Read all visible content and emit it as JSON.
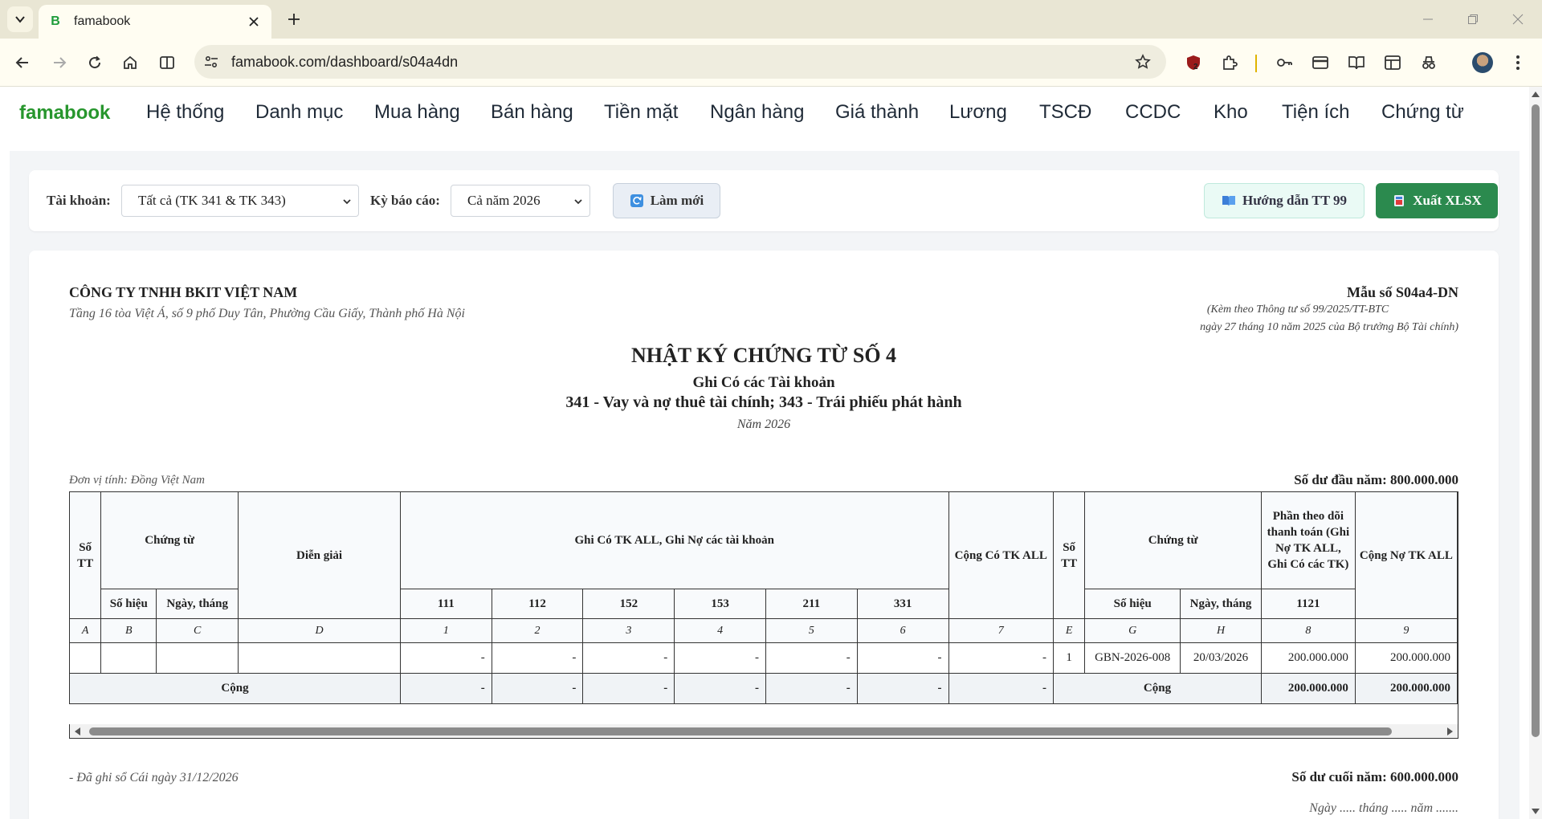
{
  "browser": {
    "tab_title": "famabook",
    "favicon_letter": "B",
    "url": "famabook.com/dashboard/s04a4dn",
    "ext_badge": "2"
  },
  "app": {
    "brand": "famabook",
    "menu": [
      "Hệ thống",
      "Danh mục",
      "Mua hàng",
      "Bán hàng",
      "Tiền mặt",
      "Ngân hàng",
      "Giá thành",
      "Lương",
      "TSCĐ",
      "CCDC",
      "Kho",
      "Tiện ích",
      "Chứng từ"
    ]
  },
  "filters": {
    "account_label": "Tài khoản:",
    "account_value": "Tất cả (TK 341 & TK 343)",
    "period_label": "Kỳ báo cáo:",
    "period_value": "Cả năm 2026",
    "refresh_label": "Làm mới",
    "guide_label": "Hướng dẫn TT 99",
    "export_label": "Xuất XLSX"
  },
  "report": {
    "company": "CÔNG TY TNHH BKIT VIỆT NAM",
    "address": "Tầng 16 tòa Việt Á, số 9 phố Duy Tân, Phường Cầu Giấy, Thành phố Hà Nội",
    "form_no": "Mẫu số S04a4-DN",
    "form_note1": "(Kèm theo Thông tư số 99/2025/TT-BTC",
    "form_note2": "ngày 27 tháng 10 năm 2025 của Bộ trưởng Bộ Tài chính)",
    "title": "NHẬT KÝ CHỨNG TỪ SỐ 4",
    "subtitle1": "Ghi Có các Tài khoản",
    "subtitle2": "341 - Vay và nợ thuê tài chính; 343 - Trái phiếu phát hành",
    "year": "Năm 2026",
    "unit": "Đơn vị tính: Đồng Việt Nam",
    "opening_balance": "Số dư đầu năm: 800.000.000",
    "posted": "- Đã ghi sổ Cái ngày 31/12/2026",
    "closing_balance": "Số dư cuối năm: 600.000.000",
    "date_line": "Ngày ..... tháng ..... năm ......."
  },
  "table": {
    "h_stt": "Số TT",
    "h_chungtu": "Chứng từ",
    "h_diengiai": "Diễn giải",
    "h_ghico": "Ghi Có TK ALL, Ghi Nợ các tài khoản",
    "h_congco": "Cộng Có TK ALL",
    "h_stt2": "Số TT",
    "h_chungtu2": "Chứng từ",
    "h_phantheodoi": "Phần theo dõi thanh toán (Ghi Nợ TK ALL, Ghi Có các TK)",
    "h_congno": "Cộng Nợ TK ALL",
    "h_sohieu": "Số hiệu",
    "h_ngaythang": "Ngày, tháng",
    "h_sohieu2": "Số hiệu",
    "h_ngaythang2": "Ngày, tháng",
    "accounts": [
      "111",
      "112",
      "152",
      "153",
      "211",
      "331"
    ],
    "acct_1121": "1121",
    "letters": [
      "A",
      "B",
      "C",
      "D",
      "1",
      "2",
      "3",
      "4",
      "5",
      "6",
      "7",
      "E",
      "G",
      "H",
      "8",
      "9"
    ],
    "row": {
      "stt": "",
      "sohieu": "",
      "ngay": "",
      "diengiai": "",
      "c111": "-",
      "c112": "-",
      "c152": "-",
      "c153": "-",
      "c211": "-",
      "c331": "-",
      "congco": "-",
      "stt2": "1",
      "sohieu2": "GBN-2026-008",
      "ngay2": "20/03/2026",
      "c1121": "200.000.000",
      "congno": "200.000.000"
    },
    "total": {
      "label": "Cộng",
      "c111": "-",
      "c112": "-",
      "c152": "-",
      "c153": "-",
      "c211": "-",
      "c331": "-",
      "congco": "-",
      "label2": "Cộng",
      "c1121": "200.000.000",
      "congno": "200.000.000"
    }
  }
}
